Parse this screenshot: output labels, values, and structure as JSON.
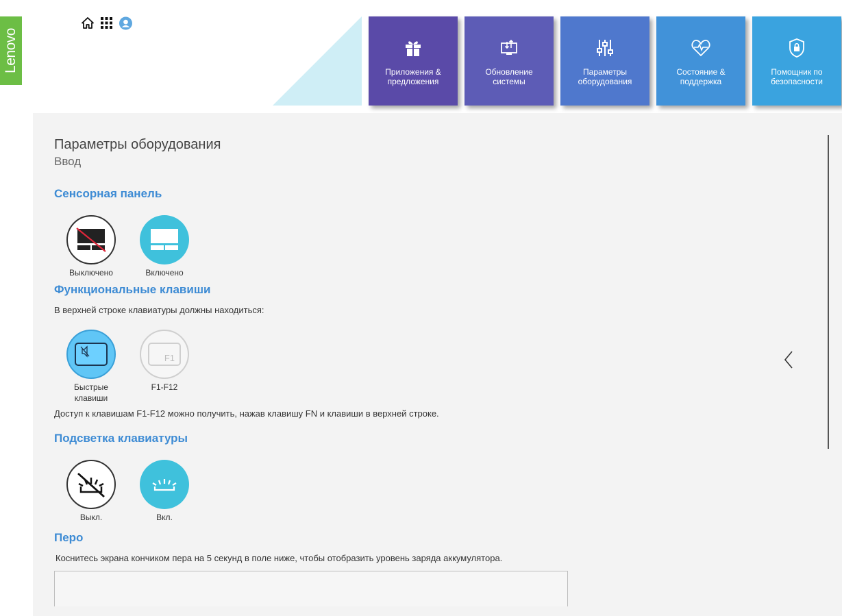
{
  "brand": {
    "logo_text": "Lenovo"
  },
  "topbar": {
    "icons": [
      "home-icon",
      "apps-grid-icon",
      "account-icon"
    ]
  },
  "nav_tiles": [
    {
      "label": "Приложения & предложения",
      "icon": "gift-icon",
      "color": "#5a4aa8"
    },
    {
      "label": "Обновление системы",
      "icon": "system-update-icon",
      "color": "#5d5cb6"
    },
    {
      "label": "Параметры оборудования",
      "icon": "sliders-icon",
      "color": "#4f78cd"
    },
    {
      "label": "Состояние & поддержка",
      "icon": "heart-pulse-icon",
      "color": "#4192d9"
    },
    {
      "label": "Помощник по безопасности",
      "icon": "shield-lock-icon",
      "color": "#3aa3df"
    }
  ],
  "page": {
    "title": "Параметры оборудования",
    "subtitle": "Ввод"
  },
  "touchpad": {
    "title": "Сенсорная панель",
    "selected": "Включено",
    "options": [
      {
        "label": "Выключено",
        "icon": "touchpad-off-icon"
      },
      {
        "label": "Включено",
        "icon": "touchpad-on-icon"
      }
    ]
  },
  "function_keys": {
    "title": "Функциональные клавиши",
    "description": "В верхней строке клавиатуры должны находиться:",
    "selected": "Быстрые клавиши",
    "options": [
      {
        "label": "Быстрые клавиши",
        "icon": "hotkey-mute-icon"
      },
      {
        "label": "F1-F12",
        "icon": "f1-key-icon",
        "key_text": "F1"
      }
    ],
    "note": "Доступ к клавишам F1-F12 можно получить, нажав клавишу FN и клавиши в верхней строке."
  },
  "backlight": {
    "title": "Подсветка клавиатуры",
    "selected": "Вкл.",
    "options": [
      {
        "label": "Выкл.",
        "icon": "backlight-off-icon"
      },
      {
        "label": "Вкл.",
        "icon": "backlight-on-icon"
      }
    ]
  },
  "pen": {
    "title": "Перо",
    "description": "Коснитесь экрана кончиком пера на 5 секунд в поле ниже, чтобы отобразить уровень заряда аккумулятора."
  },
  "colors": {
    "lenovo_green": "#6cbe45",
    "accent_blue": "#3d8bd4",
    "toggle_on": "#3fc1dc",
    "panel_bg": "#f3f3f3"
  }
}
